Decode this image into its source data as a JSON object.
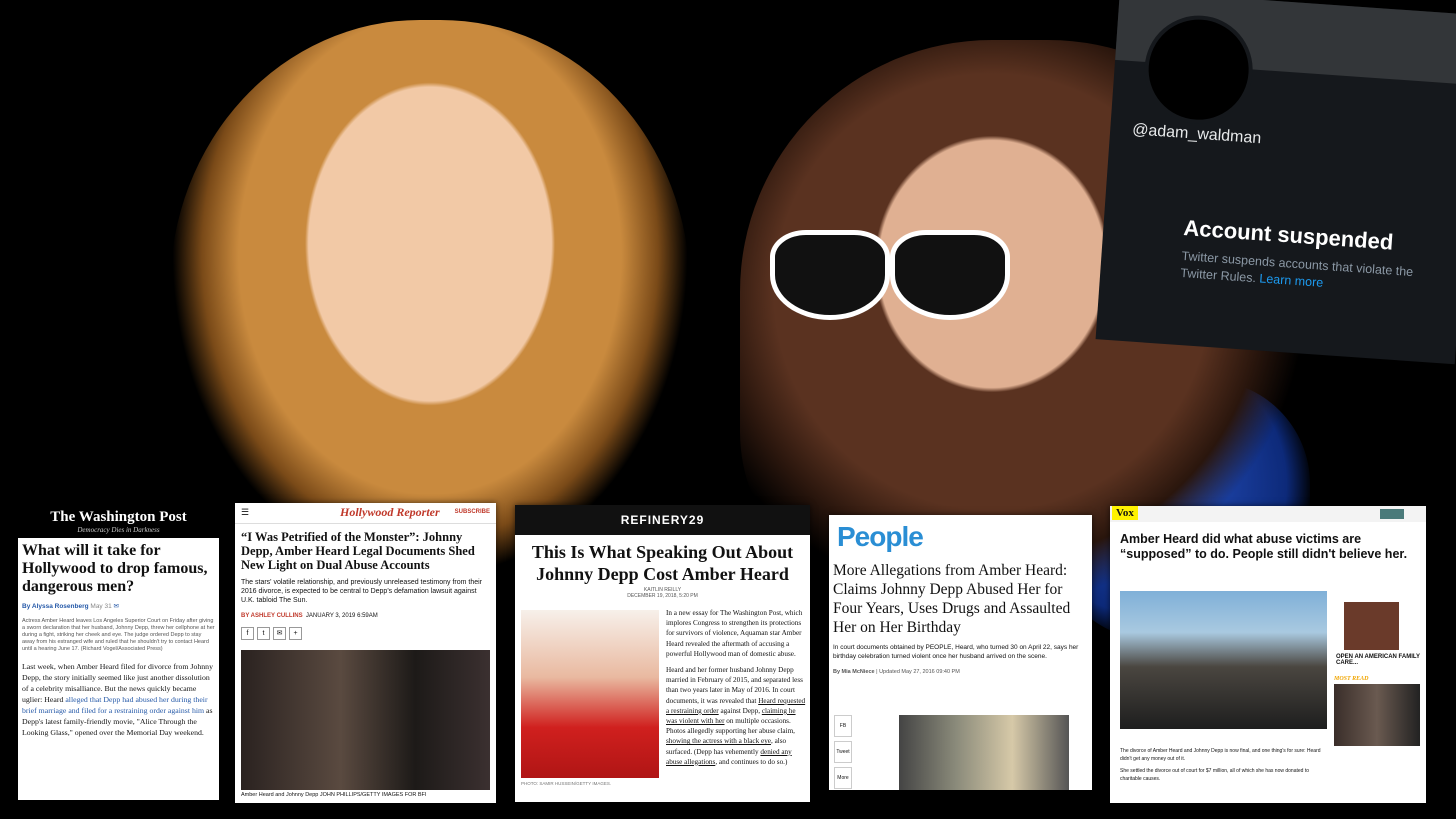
{
  "twitter": {
    "handle": "@adam_waldman",
    "heading": "Account suspended",
    "body": "Twitter suspends accounts that violate the Twitter Rules.",
    "link": "Learn more"
  },
  "washington_post": {
    "logo": "The Washington Post",
    "tagline": "Democracy Dies in Darkness",
    "headline": "What will it take for Hollywood to drop famous, dangerous men?",
    "byline": "By Alyssa Rosenberg",
    "date": "May 31",
    "caption": "Actress Amber Heard leaves Los Angeles Superior Court on Friday after giving a sworn declaration that her husband, Johnny Depp, threw her cellphone at her during a fight, striking her cheek and eye. The judge ordered Depp to stay away from his estranged wife and ruled that he shouldn't try to contact Heard until a hearing June 17. (Richard Vogel/Associated Press)",
    "body_1": "Last week, when Amber Heard filed for divorce from Johnny Depp, the story initially seemed like just another dissolution of a celebrity misalliance. But the news quickly became uglier: Heard ",
    "body_link": "alleged that Depp had abused her during their brief marriage and filed for a restraining order against him",
    "body_2": " as Depp's latest family-friendly movie, \"Alice Through the Looking Glass,\" opened over the Memorial Day weekend."
  },
  "hollywood_reporter": {
    "logo": "Hollywood Reporter",
    "subscribe": "SUBSCRIBE",
    "headline": "“I Was Petrified of the Monster”: Johnny Depp, Amber Heard Legal Documents Shed New Light on Dual Abuse Accounts",
    "dek": "The stars' volatile relationship, and previously unreleased testimony from their 2016 divorce, is expected to be central to Depp's defamation lawsuit against U.K. tabloid The Sun.",
    "byline": "BY ASHLEY CULLINS",
    "date": "JANUARY 3, 2019 6:59AM",
    "caption": "Amber Heard and Johnny Depp  JOHN PHILLIPS/GETTY IMAGES FOR BFI"
  },
  "refinery29": {
    "logo": "REFINERY29",
    "headline": "This Is What Speaking Out About Johnny Depp Cost Amber Heard",
    "author": "KAITLIN REILLY",
    "date": "DECEMBER 19, 2018, 5:20 PM",
    "photo_credit": "PHOTO: SAMIR HUSSEIN/GETTY IMAGES.",
    "p1": "In a new essay for The Washington Post, which implores Congress to strengthen its protections for survivors of violence, Aquaman star Amber Heard revealed the aftermath of accusing a powerful Hollywood man of domestic abuse.",
    "p2a": "Heard and her former husband Johnny Depp married in February of 2015, and separated less than two years later in May of 2016. In court documents, it was revealed that ",
    "p2_link1": "Heard requested a restraining order",
    "p2b": " against Depp, ",
    "p2_link2": "claiming he was violent with her",
    "p2c": " on multiple occasions. Photos allegedly supporting her abuse claim, ",
    "p2_link3": "showing the actress with a black eye",
    "p2d": ", also surfaced. (Depp has vehemently ",
    "p2_link4": "denied any abuse allegations",
    "p2e": ", and continues to do so.)"
  },
  "people": {
    "logo": "People",
    "headline": "More Allegations from Amber Heard: Claims Johnny Depp Abused Her for Four Years, Uses Drugs and Assaulted Her on Her Birthday",
    "dek": "In court documents obtained by PEOPLE, Heard, who turned 30 on April 22, says her birthday celebration turned violent once her husband arrived on the scene.",
    "byline": "By Mia McNiece",
    "date": "Updated May 27, 2016 09:40 PM",
    "share_1": "FB",
    "share_2": "Tweet",
    "share_3": "More"
  },
  "vox": {
    "logo": "Vox",
    "headline": "Amber Heard did what abuse victims are “supposed” to do. People still didn't believe her.",
    "ad_title": "OPEN AN AMERICAN FAMILY CARE...",
    "most_read": "MOST READ",
    "body_1": "The divorce of Amber Heard and Johnny Depp is now final, and one thing's for sure: Heard didn't get any money out of it.",
    "body_2": "She settled the divorce out of court for $7 million, all of which she has now donated to charitable causes."
  }
}
